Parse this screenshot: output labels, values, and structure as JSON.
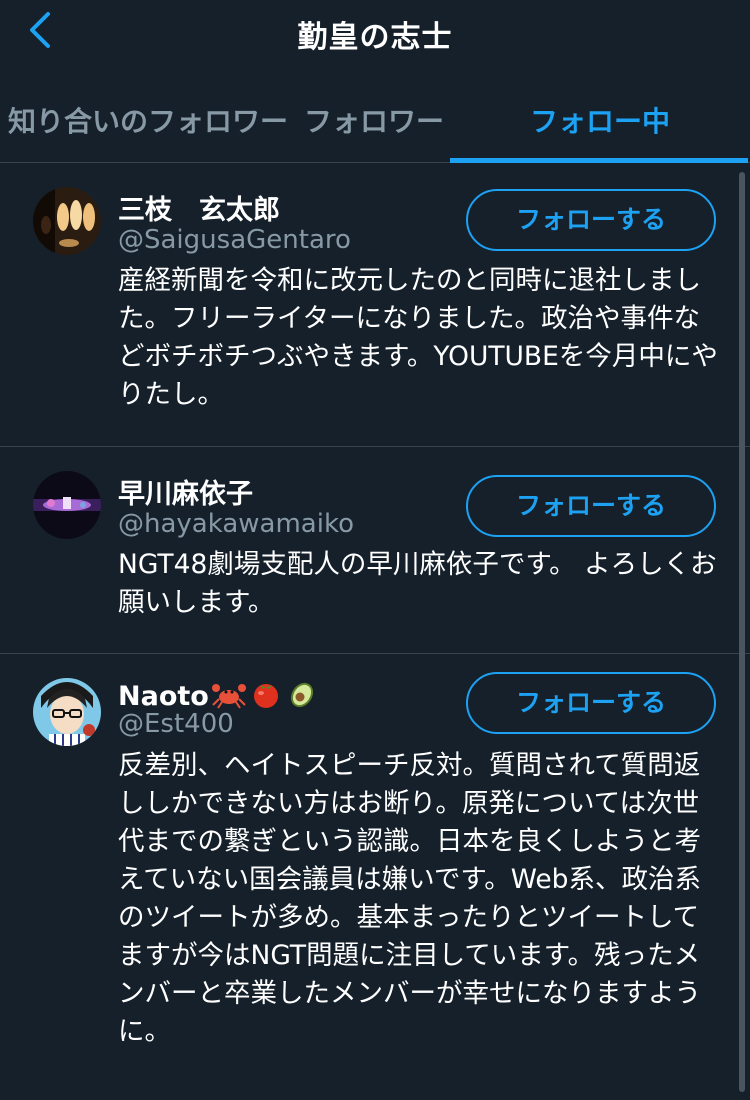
{
  "header": {
    "title": "勤皇の志士"
  },
  "tabs": [
    {
      "label": "知り合いのフォロワー",
      "active": false
    },
    {
      "label": "フォロワー",
      "active": false
    },
    {
      "label": "フォロー中",
      "active": true
    }
  ],
  "users": [
    {
      "name": "三枝　玄太郎",
      "handle": "@SaigusaGentaro",
      "bio": "産経新聞を令和に改元したのと同時に退社しました。フリーライターになりました。政治や事件などボチボチつぶやきます。YOUTUBEを今月中にやりたし。",
      "button": "フォローする"
    },
    {
      "name": "早川麻依子",
      "handle": "@hayakawamaiko",
      "bio": "NGT48劇場支配人の早川麻依子です。 よろしくお願いします。",
      "button": "フォローする"
    },
    {
      "name": "Naoto",
      "name_emoji": [
        "crab",
        "tomato",
        "avocado"
      ],
      "handle": "@Est400",
      "bio": "反差別、ヘイトスピーチ反対。質問されて質問返ししかできない方はお断り。原発については次世代までの繋ぎという認識。日本を良くしようと考えていない国会議員は嫌いです。Web系、政治系のツイートが多め。基本まったりとツイートしてますが今はNGT問題に注目しています。残ったメンバーと卒業したメンバーが幸せになりますように。",
      "button": "フォローする"
    }
  ],
  "colors": {
    "background": "#15202b",
    "accent": "#1da1f2",
    "secondary_text": "#8899a6",
    "divider": "#38444d"
  }
}
